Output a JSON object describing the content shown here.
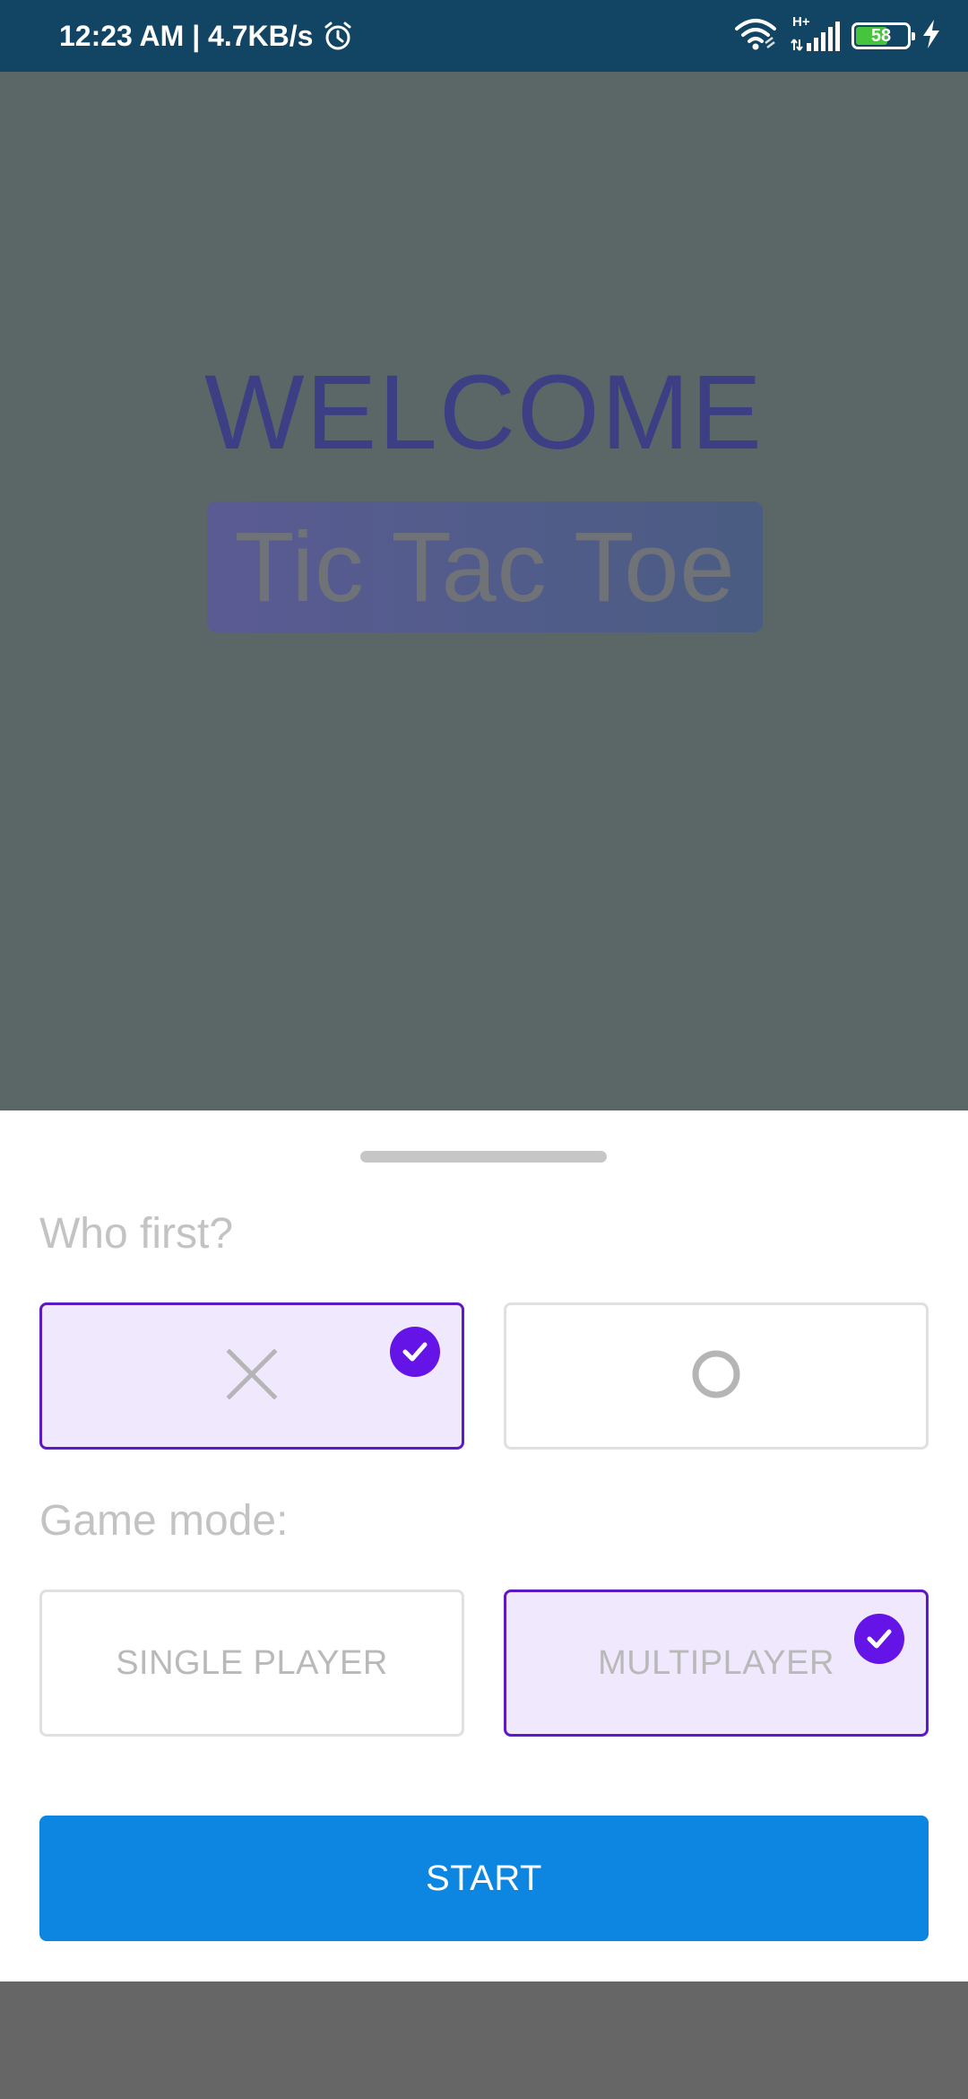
{
  "status_bar": {
    "time_speed": "12:23 AM | 4.7KB/s",
    "network_type": "H+",
    "battery_level": "58",
    "icons": [
      "alarm-icon",
      "wifi-icon",
      "signal-icon",
      "battery-icon",
      "charging-icon"
    ]
  },
  "main": {
    "welcome": "WELCOME",
    "title": "Tic Tac Toe"
  },
  "sheet": {
    "who_first_label": "Who first?",
    "first_options": [
      {
        "symbol": "x-icon",
        "selected": true
      },
      {
        "symbol": "o-icon",
        "selected": false
      }
    ],
    "game_mode_label": "Game mode:",
    "mode_options": [
      {
        "label": "SINGLE PLAYER",
        "selected": false
      },
      {
        "label": "MULTIPLAYER",
        "selected": true
      }
    ],
    "start_label": "START"
  },
  "colors": {
    "status_bar": "#124563",
    "accent": "#6414e7",
    "selected_border": "#5d18c7",
    "selected_fill": "#f0e9fd",
    "start_button": "#0c86e0",
    "scrim": "#5b6766"
  }
}
